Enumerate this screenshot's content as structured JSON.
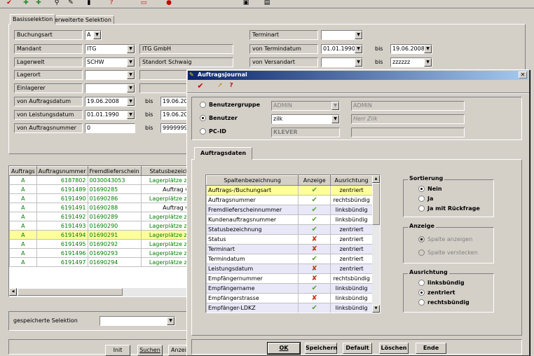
{
  "main": {
    "tabs": [
      "Basisselektion",
      "erweiterte Selektion"
    ],
    "labels": {
      "buchungsart": "Buchungsart",
      "mandant": "Mandant",
      "lagerwelt": "Lagerwelt",
      "lagerort": "Lagerort",
      "einlagerer": "Einlagerer",
      "auftragsdatum": "von Auftragsdatum",
      "leistungsdatum": "von Leistungsdatum",
      "auftragsnummer": "von Auftragsnummer",
      "terminart": "Terminart",
      "termindatum": "von Termindatum",
      "versandart": "von Versandart",
      "bis": "bis"
    },
    "values": {
      "buchungsart": "A",
      "mandant": "ITG",
      "mandant_name": "ITG GmbH",
      "lagerwelt": "SCHW",
      "lagerwelt_name": "Standort Schwaig",
      "auftragsdatum": "19.06.2008",
      "auftragsdatum_bis": "19.06.2008",
      "leistungsdatum": "01.01.1990",
      "leistungsdatum_bis": "19.06.2008",
      "auftragsnummer": "0",
      "auftragsnummer_bis": "99999999",
      "termindatum": "01.01.1990",
      "termindatum_bis": "19.06.2008",
      "versandart_bis": "zzzzzz"
    },
    "list": {
      "headers": [
        "Auftrags",
        "Auftragsnummer",
        "Fremdlieferschein",
        "Statusbezeichnung"
      ],
      "rows": [
        [
          "A",
          "6187802",
          "0030043053",
          "Lagerplätze zugeordn"
        ],
        [
          "A",
          "6191489",
          "01690285",
          "Auftrag verbucht"
        ],
        [
          "A",
          "6191490",
          "01690286",
          "Lagerplätze zugeordn"
        ],
        [
          "A",
          "6191491",
          "01690288",
          "Auftrag verbucht"
        ],
        [
          "A",
          "6191492",
          "01690289",
          "Lagerplätze zugeordn"
        ],
        [
          "A",
          "6191493",
          "01690290",
          "Lagerplätze zugeordn"
        ],
        [
          "A",
          "6191494",
          "01690291",
          "Lagerplätze zugeordn"
        ],
        [
          "A",
          "6191495",
          "01690292",
          "Lagerplätze zugeordn"
        ],
        [
          "A",
          "6191496",
          "01690293",
          "Lagerplätze zugeordn"
        ],
        [
          "A",
          "6191497",
          "01690294",
          "Lagerplätze zugeordn"
        ]
      ]
    },
    "saved_selection_label": "gespeicherte Selektion",
    "buttons": {
      "init": "Init",
      "suchen": "Suchen",
      "anzeigen": "Anzei"
    }
  },
  "dialog": {
    "title": "Auftragsjournal",
    "benutzergruppe_label": "Benutzergruppe",
    "benutzergruppe_value": "ADMIN",
    "benutzergruppe_name": "ADMIN",
    "benutzer_label": "Benutzer",
    "benutzer_value": "zilk",
    "benutzer_name": "Herr Zilk",
    "pcid_label": "PC-ID",
    "pcid_value": "KLEVER",
    "tab": "Auftragsdaten",
    "grid": {
      "headers": [
        "Spaltenbezeichnung",
        "Anzeige",
        "Ausrichtung"
      ],
      "rows": [
        {
          "name": "Auftrags-/Buchungsart",
          "show": "check",
          "align": "zentriert"
        },
        {
          "name": "Auftragsnummer",
          "show": "check",
          "align": "rechtsbündig"
        },
        {
          "name": "Fremdlieferscheinnummer",
          "show": "check",
          "align": "linksbündig"
        },
        {
          "name": "Kundenauftragsnummer",
          "show": "check",
          "align": "linksbündig"
        },
        {
          "name": "Statusbezeichnung",
          "show": "check",
          "align": "zentriert"
        },
        {
          "name": "Status",
          "show": "cross",
          "align": "zentriert"
        },
        {
          "name": "Terminart",
          "show": "cross",
          "align": "zentriert"
        },
        {
          "name": "Termindatum",
          "show": "check",
          "align": "zentriert"
        },
        {
          "name": "Leistungsdatum",
          "show": "cross",
          "align": "zentriert"
        },
        {
          "name": "Empfängernummer",
          "show": "cross",
          "align": "rechtsbündig"
        },
        {
          "name": "Empfängername",
          "show": "check",
          "align": "linksbündig"
        },
        {
          "name": "Empfängerstrasse",
          "show": "cross",
          "align": "linksbündig"
        },
        {
          "name": "Empfänger-LDKZ",
          "show": "check",
          "align": "linksbündig"
        }
      ]
    },
    "sortierung": {
      "title": "Sortierung",
      "options": [
        "Nein",
        "Ja",
        "Ja mit Rückfrage"
      ]
    },
    "anzeige": {
      "title": "Anzeige",
      "options": [
        "Spalte anzeigen",
        "Spalte verstecken"
      ]
    },
    "ausrichtung": {
      "title": "Ausrichtung",
      "options": [
        "linksbündig",
        "zentriert",
        "rechtsbündig"
      ]
    },
    "buttons": {
      "ok": "OK",
      "speichern": "Speichern",
      "default": "Default",
      "loeschen": "Löschen",
      "ende": "Ende"
    }
  },
  "colors": {
    "titlebar": "#0a246a",
    "highlight_row": "#ffff99",
    "green_text": "#008000",
    "check": "#5aa02c",
    "cross": "#c0391b"
  }
}
